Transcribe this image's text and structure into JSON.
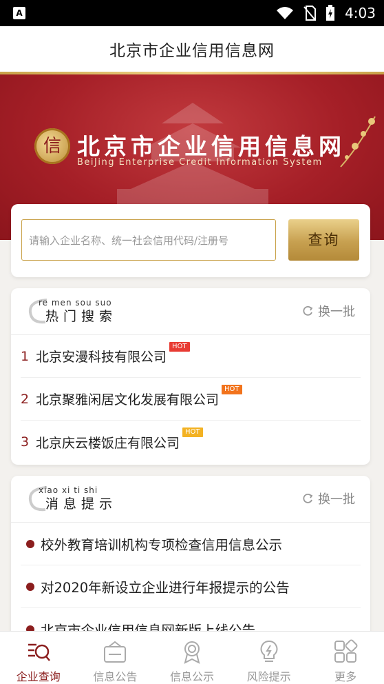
{
  "status_bar": {
    "time": "4:03",
    "left_icon_letter": "A"
  },
  "app_bar": {
    "title": "北京市企业信用信息网"
  },
  "banner": {
    "seal_char": "信",
    "brand_cn": "北京市企业信用信息网",
    "brand_en": "BeiJing Enterprise Credit Information System"
  },
  "search": {
    "placeholder": "请输入企业名称、统一社会信用代码/注册号",
    "button_label": "查询"
  },
  "hot_search": {
    "pinyin": "re men sou suo",
    "title": "热门搜索",
    "refresh_label": "换一批",
    "items": [
      {
        "num": "1",
        "name": "北京安漫科技有限公司",
        "badge": "HOT",
        "badge_color": "#e83b33"
      },
      {
        "num": "2",
        "name": "北京聚雅闲居文化发展有限公司",
        "badge": "HOT",
        "badge_color": "#f2731c"
      },
      {
        "num": "3",
        "name": "北京庆云楼饭庄有限公司",
        "badge": "HOT",
        "badge_color": "#f3b223"
      }
    ]
  },
  "news": {
    "pinyin": "xiao xi ti shi",
    "title": "消息提示",
    "refresh_label": "换一批",
    "items": [
      "校外教育培训机构专项检查信用信息公示",
      "对2020年新设立企业进行年报提示的公告",
      "北京市企业信用信息网新版上线公告"
    ]
  },
  "tabs": [
    {
      "label": "企业查询",
      "icon": "search-list-icon",
      "active": true
    },
    {
      "label": "信息公告",
      "icon": "bulletin-box-icon",
      "active": false
    },
    {
      "label": "信息公示",
      "icon": "award-ribbon-icon",
      "active": false
    },
    {
      "label": "风险提示",
      "icon": "lightbulb-icon",
      "active": false
    },
    {
      "label": "更多",
      "icon": "grid-more-icon",
      "active": false
    }
  ],
  "colors": {
    "accent": "#8b1e1e",
    "gold": "#c9a24a",
    "banner_red": "#a51f27"
  }
}
